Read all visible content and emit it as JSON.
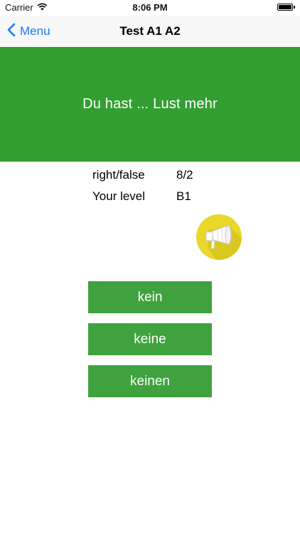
{
  "status_bar": {
    "carrier": "Carrier",
    "time": "8:06 PM",
    "battery_level": 1.0
  },
  "nav": {
    "back_label": "Menu",
    "title": "Test A1 A2"
  },
  "question": {
    "text": "Du hast ... Lust mehr"
  },
  "stats": [
    {
      "label": "right/false",
      "value": "8/2"
    },
    {
      "label": "Your level",
      "value": "B1"
    }
  ],
  "answers": [
    {
      "label": "kein"
    },
    {
      "label": "keine"
    },
    {
      "label": "keinen"
    }
  ],
  "colors": {
    "banner": "#339e31",
    "answer_button": "#3fa23e",
    "speaker_button": "#e9d729",
    "nav_tint": "#1a7af8"
  },
  "icons": {
    "back": "chevron-left-icon",
    "speaker": "megaphone-icon",
    "wifi": "wifi-icon",
    "battery": "battery-icon"
  }
}
